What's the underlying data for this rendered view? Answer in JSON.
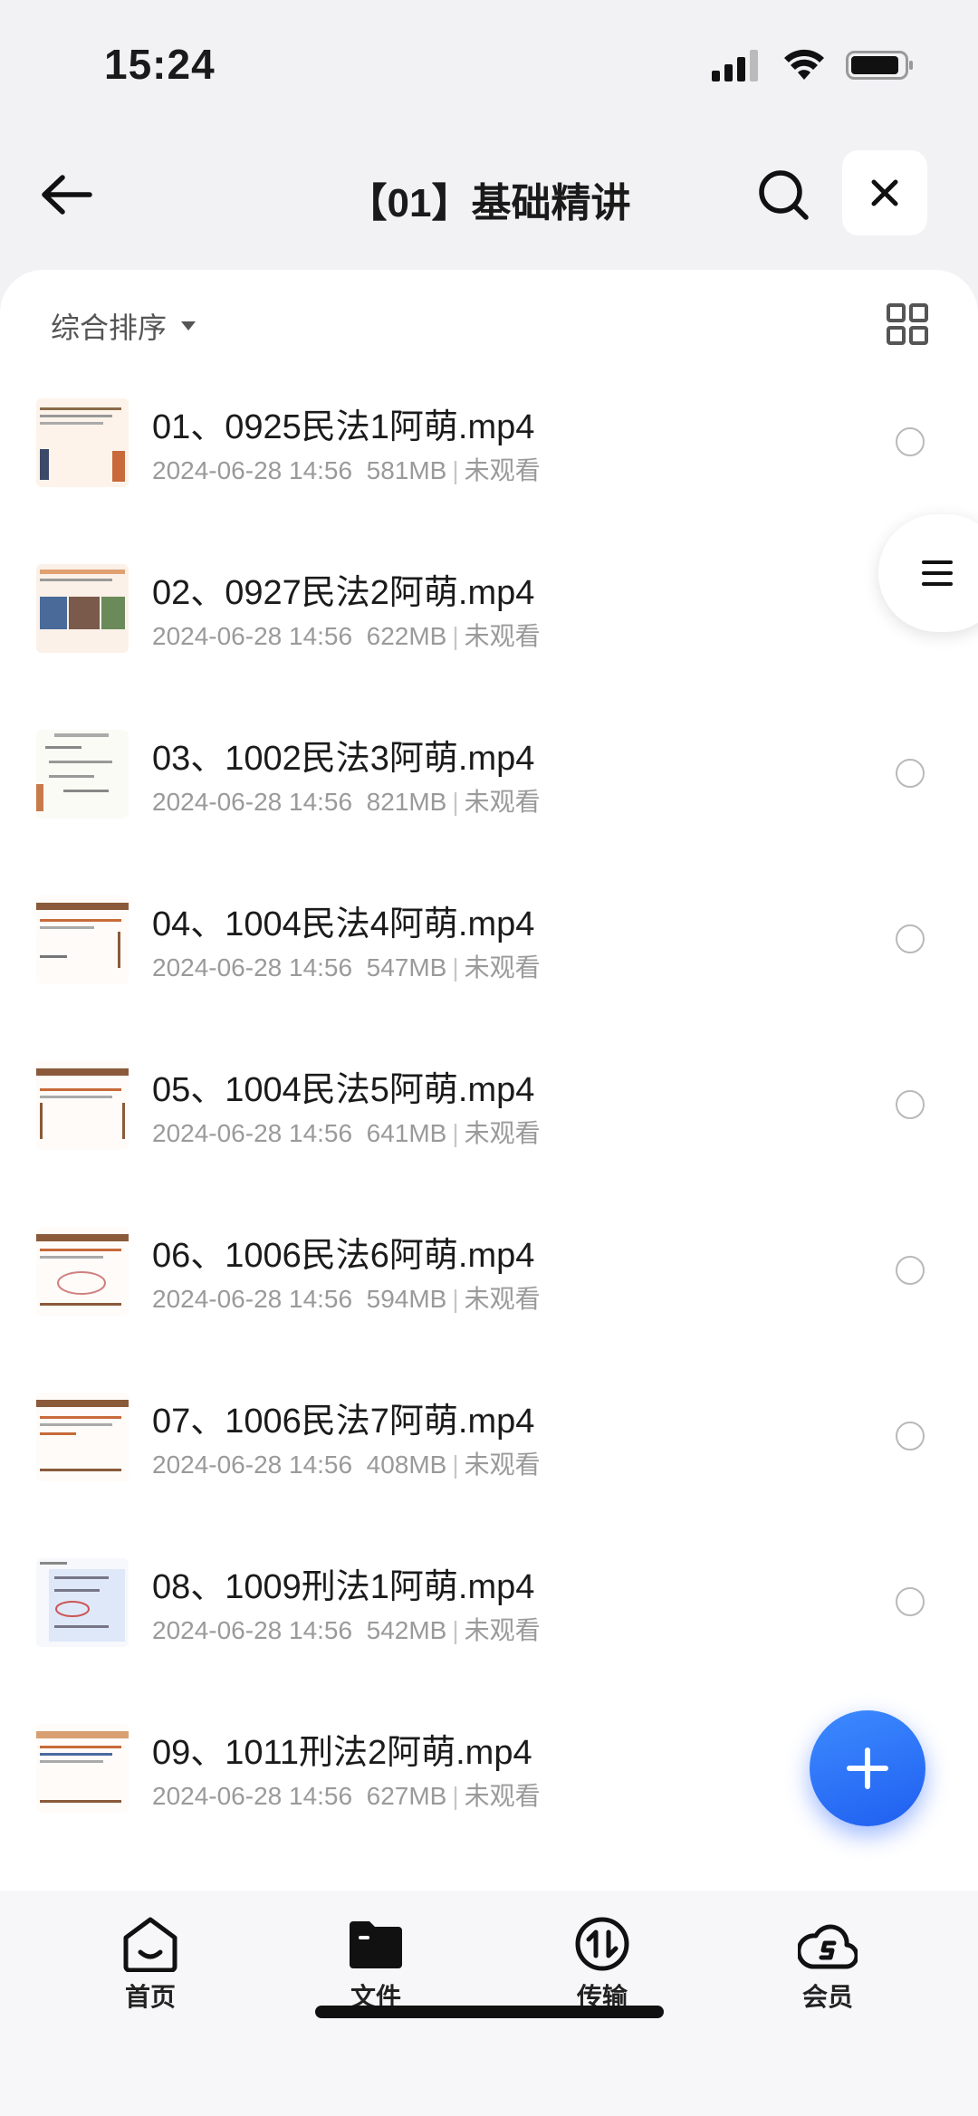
{
  "status_bar": {
    "time": "15:24"
  },
  "header": {
    "title": "【01】基础精讲"
  },
  "sort": {
    "label": "综合排序"
  },
  "files": [
    {
      "name": "01、0925民法1阿萌.mp4",
      "date": "2024-06-28 14:56",
      "size": "581MB",
      "status": "未观看"
    },
    {
      "name": "02、0927民法2阿萌.mp4",
      "date": "2024-06-28 14:56",
      "size": "622MB",
      "status": "未观看"
    },
    {
      "name": "03、1002民法3阿萌.mp4",
      "date": "2024-06-28 14:56",
      "size": "821MB",
      "status": "未观看"
    },
    {
      "name": "04、1004民法4阿萌.mp4",
      "date": "2024-06-28 14:56",
      "size": "547MB",
      "status": "未观看"
    },
    {
      "name": "05、1004民法5阿萌.mp4",
      "date": "2024-06-28 14:56",
      "size": "641MB",
      "status": "未观看"
    },
    {
      "name": "06、1006民法6阿萌.mp4",
      "date": "2024-06-28 14:56",
      "size": "594MB",
      "status": "未观看"
    },
    {
      "name": "07、1006民法7阿萌.mp4",
      "date": "2024-06-28 14:56",
      "size": "408MB",
      "status": "未观看"
    },
    {
      "name": "08、1009刑法1阿萌.mp4",
      "date": "2024-06-28 14:56",
      "size": "542MB",
      "status": "未观看"
    },
    {
      "name": "09、1011刑法2阿萌.mp4",
      "date": "2024-06-28 14:56",
      "size": "627MB",
      "status": "未观看"
    }
  ],
  "tabs": [
    {
      "label": "首页",
      "icon": "home-icon"
    },
    {
      "label": "文件",
      "icon": "folder-icon"
    },
    {
      "label": "传输",
      "icon": "transfer-icon"
    },
    {
      "label": "会员",
      "icon": "vip-icon"
    }
  ],
  "colors": {
    "accent": "#2f6ff5",
    "text": "#1b1b1b",
    "secondary": "#9a9a9a"
  }
}
